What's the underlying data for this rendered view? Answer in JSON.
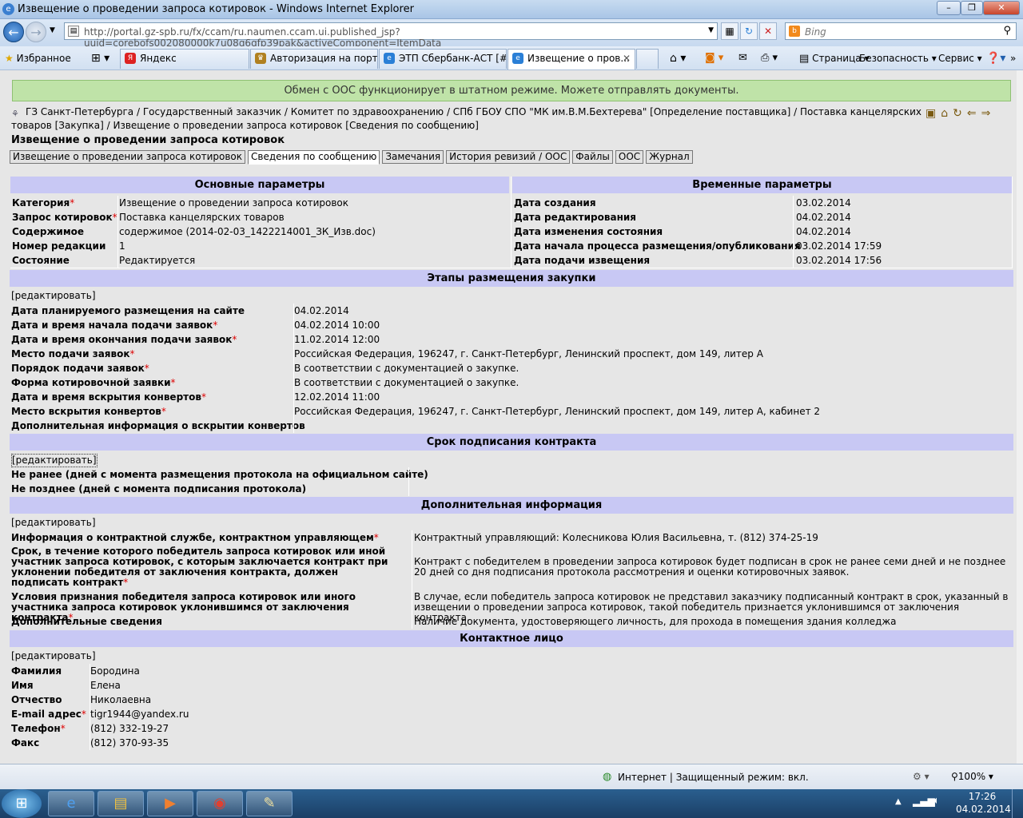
{
  "window": {
    "title": "Извещение о проведении запроса котировок - Windows Internet Explorer"
  },
  "browser": {
    "url": "http://portal.gz-spb.ru/fx/ccam/ru.naumen.ccam.ui.published_jsp?uuid=corebofs002080000k7u08g6gfp39pak&activeComponent=ItemData",
    "search_placeholder": "Bing",
    "favorites_label": "Избранное",
    "fav_links": [
      "Яндекс"
    ],
    "tabs": [
      "Авторизация на порта...",
      "ЭТП Сбербанк-АСТ [#...",
      "Извещение о пров..."
    ],
    "commands": [
      "Страница",
      "Безопасность",
      "Сервис"
    ]
  },
  "banner": "Обмен с ООС функционирует в штатном режиме. Можете отправлять документы.",
  "breadcrumb": "ГЗ Санкт-Петербурга / Государственный заказчик / Комитет по здравоохранению / СПб ГБОУ СПО \"МК им.В.М.Бехтерева\" [Определение поставщика] / Поставка канцелярских товаров [Закупка] / Извещение о проведении запроса котировок [Сведения по сообщению]",
  "page_title": "Извещение о проведении запроса котировок",
  "content_tabs": [
    "Извещение о проведении запроса котировок",
    "Сведения по сообщению",
    "Замечания",
    "История ревизий / ООС",
    "Файлы",
    "ООС",
    "Журнал"
  ],
  "edit_link": "[редактировать]",
  "basic": {
    "header": "Основные параметры",
    "rows": [
      {
        "label": "Категория",
        "req": true,
        "value": "Извещение о проведении запроса котировок"
      },
      {
        "label": "Запрос котировок",
        "req": true,
        "value": "Поставка канцелярских товаров"
      },
      {
        "label": "Содержимое",
        "req": false,
        "value": "содержимое (2014-02-03_1422214001_ЗК_Изв.doc)"
      },
      {
        "label": "Номер редакции",
        "req": false,
        "value": "1"
      },
      {
        "label": "Состояние",
        "req": false,
        "value": "Редактируется"
      }
    ]
  },
  "time": {
    "header": "Временные параметры",
    "rows": [
      {
        "label": "Дата создания",
        "value": "03.02.2014"
      },
      {
        "label": "Дата редактирования",
        "value": "04.02.2014"
      },
      {
        "label": "Дата изменения состояния",
        "value": "04.02.2014"
      },
      {
        "label": "Дата начала процесса размещения/опубликования",
        "value": "03.02.2014 17:59"
      },
      {
        "label": "Дата подачи извещения",
        "value": "03.02.2014 17:56"
      }
    ]
  },
  "stages": {
    "header": "Этапы размещения закупки",
    "rows": [
      {
        "label": "Дата планируемого размещения на сайте",
        "req": false,
        "value": "04.02.2014"
      },
      {
        "label": "Дата и время начала подачи заявок",
        "req": true,
        "value": "04.02.2014 10:00"
      },
      {
        "label": "Дата и время окончания подачи заявок",
        "req": true,
        "value": "11.02.2014 12:00"
      },
      {
        "label": "Место подачи заявок",
        "req": true,
        "value": "Российская Федерация, 196247, г. Санкт-Петербург, Ленинский проспект, дом 149, литер А"
      },
      {
        "label": "Порядок подачи заявок",
        "req": true,
        "value": "В соответствии с документацией о закупке."
      },
      {
        "label": "Форма котировочной заявки",
        "req": true,
        "value": "В соответствии с документацией о закупке."
      },
      {
        "label": "Дата и время вскрытия конвертов",
        "req": true,
        "value": "12.02.2014 11:00"
      },
      {
        "label": "Место вскрытия конвертов",
        "req": true,
        "value": "Российская Федерация, 196247, г. Санкт-Петербург, Ленинский проспект, дом 149, литер А, кабинет 2"
      },
      {
        "label": "Дополнительная информация о вскрытии конвертов",
        "req": false,
        "value": ""
      }
    ]
  },
  "contract": {
    "header": "Срок подписания контракта",
    "rows": [
      {
        "label": "Не ранее (дней с момента размещения протокола на официальном сайте)",
        "value": ""
      },
      {
        "label": "Не позднее (дней с момента подписания протокола)",
        "value": ""
      }
    ]
  },
  "additional": {
    "header": "Дополнительная информация",
    "rows": [
      {
        "label": "Информация о контрактной службе, контрактном управляющем",
        "req": true,
        "value": "Контрактный управляющий: Колесникова Юлия Васильевна, т. (812) 374-25-19"
      },
      {
        "label": "Срок, в течение которого победитель запроса котировок или иной участник запроса котировок, с которым заключается контракт при уклонении победителя от заключения контракта, должен подписать контракт",
        "req": true,
        "value": "Контракт с победителем в проведении запроса котировок будет подписан в срок не ранее семи дней и не позднее 20 дней со дня подписания протокола рассмотрения и оценки котировочных заявок."
      },
      {
        "label": "Условия признания победителя запроса котировок или иного участника запроса котировок уклонившимся от заключения контракта",
        "req": true,
        "value": "В случае, если победитель запроса котировок не представил заказчику подписанный контракт в срок, указанный в извещении о проведении запроса котировок, такой победитель признается уклонившимся от заключения контракта."
      },
      {
        "label": "Дополнительные сведения",
        "req": false,
        "value": "Наличие документа, удостоверяющего личность, для прохода в помещения здания колледжа"
      }
    ]
  },
  "contact": {
    "header": "Контактное лицо",
    "rows": [
      {
        "label": "Фамилия",
        "req": false,
        "value": "Бородина"
      },
      {
        "label": "Имя",
        "req": false,
        "value": "Елена"
      },
      {
        "label": "Отчество",
        "req": false,
        "value": "Николаевна"
      },
      {
        "label": "E-mail адрес",
        "req": true,
        "value": "tigr1944@yandex.ru"
      },
      {
        "label": "Телефон",
        "req": true,
        "value": "(812) 332-19-27"
      },
      {
        "label": "Факс",
        "req": false,
        "value": "(812) 370-93-35"
      }
    ]
  },
  "statusbar": {
    "zone": "Интернет | Защищенный режим: вкл.",
    "zoom": "100%"
  },
  "taskbar": {
    "time": "17:26",
    "date": "04.02.2014"
  }
}
